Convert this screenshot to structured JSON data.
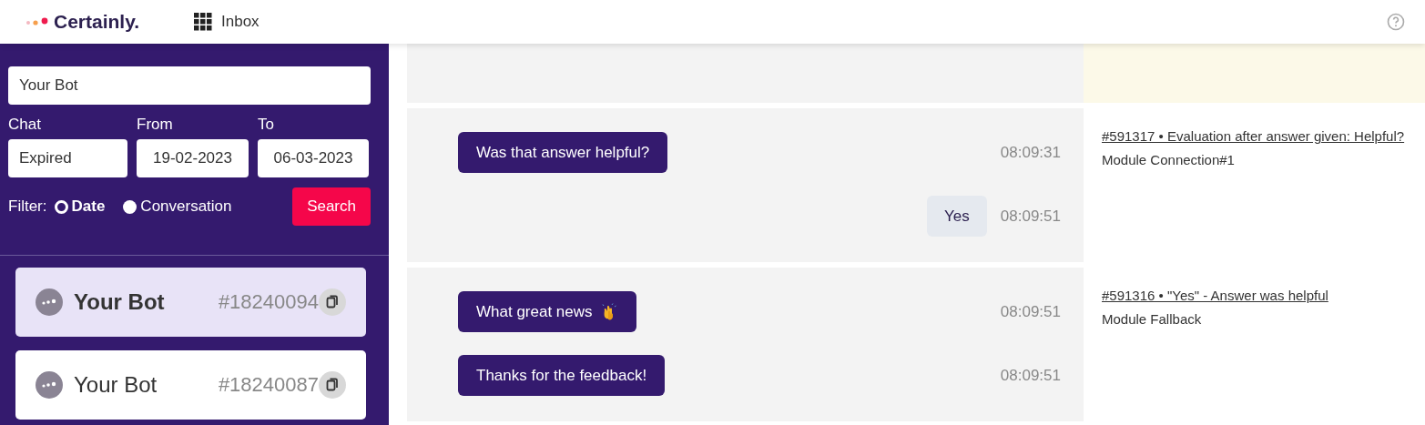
{
  "header": {
    "brand": "Certainly.",
    "nav": "Inbox"
  },
  "sidebar": {
    "bot_field": {
      "value": "Your Bot"
    },
    "chat": {
      "label": "Chat",
      "value": "Expired"
    },
    "from": {
      "label": "From",
      "value": "19-02-2023"
    },
    "to": {
      "label": "To",
      "value": "06-03-2023"
    },
    "filter": {
      "label": "Filter:",
      "options": [
        {
          "label": "Date",
          "selected": true
        },
        {
          "label": "Conversation",
          "selected": false
        }
      ]
    },
    "search_button": "Search",
    "conversations": [
      {
        "name": "Your Bot",
        "id": "#18240094",
        "selected": true
      },
      {
        "name": "Your Bot",
        "id": "#18240087",
        "selected": false
      }
    ]
  },
  "groups": [
    {
      "highlighted": true
    },
    {
      "highlighted": false,
      "link": "#591317 • Evaluation after answer given: Helpful?",
      "module": "Module Connection#1",
      "messages": [
        {
          "kind": "bot",
          "text": "Was that answer helpful?",
          "time": "08:09:31"
        },
        {
          "kind": "user",
          "text": "Yes",
          "time": "08:09:51"
        }
      ]
    },
    {
      "highlighted": false,
      "link": "#591316 • \"Yes\" - Answer was helpful",
      "module": "Module Fallback",
      "messages": [
        {
          "kind": "bot",
          "text": "What great news",
          "emoji": true,
          "time": "08:09:51"
        },
        {
          "kind": "bot",
          "text": "Thanks for the feedback!",
          "time": "08:09:51"
        }
      ]
    }
  ]
}
